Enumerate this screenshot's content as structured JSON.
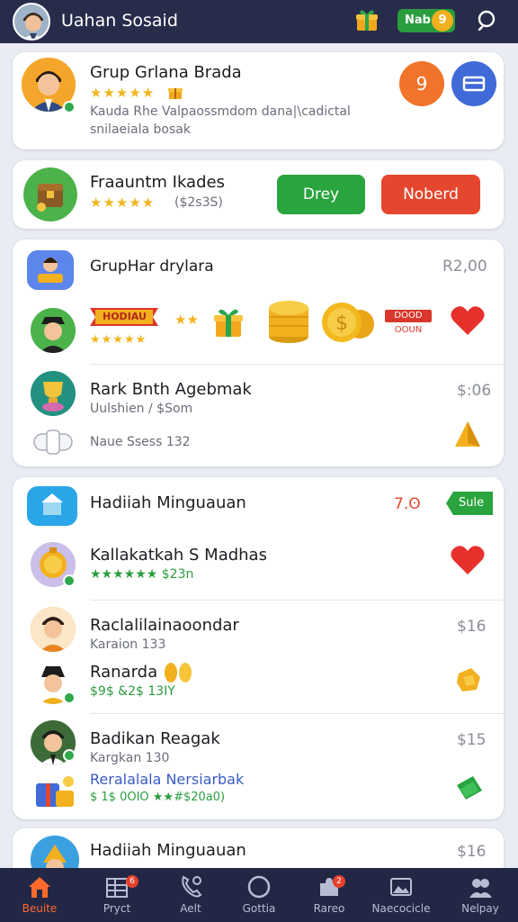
{
  "header": {
    "title": "Uahan Sosaid",
    "coin_label": "Nab",
    "coin_count": "9"
  },
  "card1": {
    "name": "Grup Grlana Brada",
    "stars": "★★★★★",
    "description_line1": "Kauda Rhe Valpaossmdom dana|\\cadictal",
    "description_line2": "snilaeiala bosak",
    "orange_btn_label": "9"
  },
  "card2": {
    "name": "Fraauntm Ikades",
    "stars": "★★★★★",
    "price_note": "($2s3S)",
    "btn_green": "Drey",
    "btn_red": "Noberd"
  },
  "card3": {
    "title": "GrupHar drylara",
    "price": "R2,00",
    "ribbon_label": "HODIAU",
    "row2_stars": "★★★★★",
    "tag_line1": "DOOD",
    "tag_line2": "OOUN",
    "row3_name": "Rark Bnth Agebmak",
    "row3_sub": "Uulshien ∕ $Som",
    "row3_price": "$:06",
    "row3_extra": "Naue Ssess 132"
  },
  "card4": {
    "title": "Hadiiah Minguauan",
    "value_red": "7.ʘ",
    "badge_green": "Sule",
    "rows": [
      {
        "name": "Kallakatkah S Madhas",
        "sub": "★★★★★★ $23n",
        "price": ""
      },
      {
        "name": "Raclalilainaoondar",
        "sub": "Karaion 133",
        "price": "$16"
      },
      {
        "name": "Ranarda",
        "sub": "$9$ &2$ 13IY",
        "price": ""
      },
      {
        "name": "Badikan Reagak",
        "sub": "Kargkan 130",
        "price": "$15"
      },
      {
        "name": "Reralalala Nersiarbak",
        "sub": "$ 1$ 0OIO ★★#$20a0)",
        "price": ""
      }
    ]
  },
  "card5": {
    "title": "Hadiiah Minguauan",
    "price": "$16"
  },
  "nav": {
    "items": [
      {
        "label": "Beuite",
        "icon": "home-icon"
      },
      {
        "label": "Pryct",
        "icon": "grid-icon",
        "badge": "6"
      },
      {
        "label": "Aelt",
        "icon": "phone-icon"
      },
      {
        "label": "Gottia",
        "icon": "circle-icon"
      },
      {
        "label": "Rareo",
        "icon": "puzzle-icon",
        "badge": "2"
      },
      {
        "label": "Naecocicle",
        "icon": "gallery-icon"
      },
      {
        "label": "Nelpay",
        "icon": "people-icon"
      }
    ]
  },
  "colors": {
    "header_bg": "#282c4b",
    "accent_green": "#2a9d3e",
    "accent_red": "#e4472e",
    "accent_orange": "#f2732a",
    "accent_blue": "#3f6ad8",
    "star": "#f2b51c"
  }
}
